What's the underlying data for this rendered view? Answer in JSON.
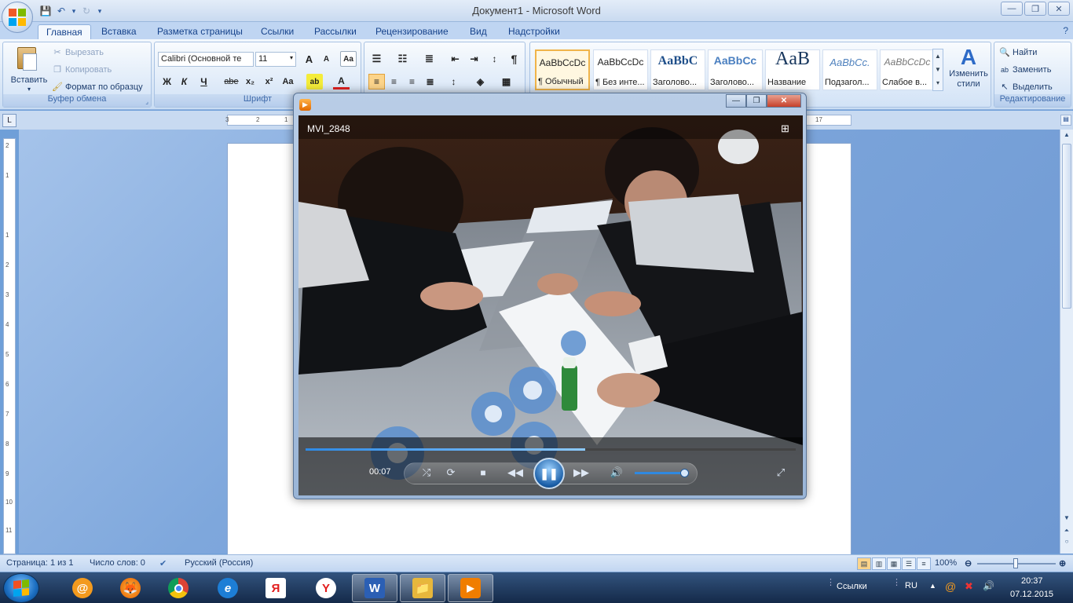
{
  "window": {
    "title": "Документ1 - Microsoft Word",
    "minimize": "—",
    "restore": "❐",
    "close": "✕"
  },
  "quick_access": {
    "save": "💾",
    "undo": "↶",
    "redo": "↻",
    "more": "▾"
  },
  "tabs": [
    "Главная",
    "Вставка",
    "Разметка страницы",
    "Ссылки",
    "Рассылки",
    "Рецензирование",
    "Вид",
    "Надстройки"
  ],
  "ribbon": {
    "clipboard": {
      "label": "Буфер обмена",
      "paste": "Вставить",
      "cut": "Вырезать",
      "copy": "Копировать",
      "format_painter": "Формат по образцу"
    },
    "font": {
      "label": "Шрифт",
      "font_name": "Calibri (Основной те",
      "font_size": "11",
      "bold": "Ж",
      "italic": "К",
      "underline": "Ч",
      "strike": "abe",
      "subscript": "x₂",
      "superscript": "x²",
      "change_case": "Aa",
      "grow": "A",
      "shrink": "A"
    },
    "styles": {
      "items": [
        {
          "sample": "AaBbCcDc",
          "name": "¶ Обычный"
        },
        {
          "sample": "AaBbCcDc",
          "name": "¶ Без инте..."
        },
        {
          "sample": "AaBbC",
          "name": "Заголово..."
        },
        {
          "sample": "AaBbCc",
          "name": "Заголово..."
        },
        {
          "sample": "AaB",
          "name": "Название"
        },
        {
          "sample": "AaBbCc.",
          "name": "Подзагол..."
        },
        {
          "sample": "AaBbCcDc",
          "name": "Слабое в..."
        }
      ],
      "change_styles": "Изменить стили"
    },
    "editing": {
      "label": "Редактирование",
      "find": "Найти",
      "replace": "Заменить",
      "select": "Выделить"
    }
  },
  "ruler": {
    "corner": "L",
    "h_labels": [
      "3",
      "2",
      "1",
      "17"
    ],
    "v_labels": [
      "2",
      "1",
      "1",
      "2",
      "3",
      "4",
      "5",
      "6",
      "7",
      "8",
      "9",
      "10",
      "11"
    ]
  },
  "statusbar": {
    "page": "Страница: 1 из 1",
    "words": "Число слов: 0",
    "language": "Русский (Россия)",
    "zoom": "100%"
  },
  "player": {
    "title": "MVI_2848",
    "time": "00:07",
    "progress": 0.57,
    "volume": 0.85
  },
  "taskbar": {
    "apps": [
      {
        "name": "mail-ru",
        "glyph": "@",
        "color": "#f39a1e",
        "open": false
      },
      {
        "name": "firefox",
        "glyph": "🦊",
        "color": "#e66000",
        "open": false
      },
      {
        "name": "chrome",
        "glyph": "◉",
        "color": "#3a9a3a",
        "open": false
      },
      {
        "name": "internet-explorer",
        "glyph": "e",
        "color": "#1d7ed6",
        "open": false
      },
      {
        "name": "yandex",
        "glyph": "Я",
        "color": "#e21b1b",
        "open": false
      },
      {
        "name": "yandex-browser",
        "glyph": "Y",
        "color": "#e21b1b",
        "open": false
      },
      {
        "name": "word",
        "glyph": "W",
        "color": "#2b5fb4",
        "open": true
      },
      {
        "name": "explorer",
        "glyph": "📁",
        "color": "#e7b73c",
        "open": true
      },
      {
        "name": "media-player",
        "glyph": "▶",
        "color": "#f07d00",
        "open": true
      }
    ],
    "links": "Ссылки",
    "lang": "RU",
    "time": "20:37",
    "date": "07.12.2015"
  }
}
